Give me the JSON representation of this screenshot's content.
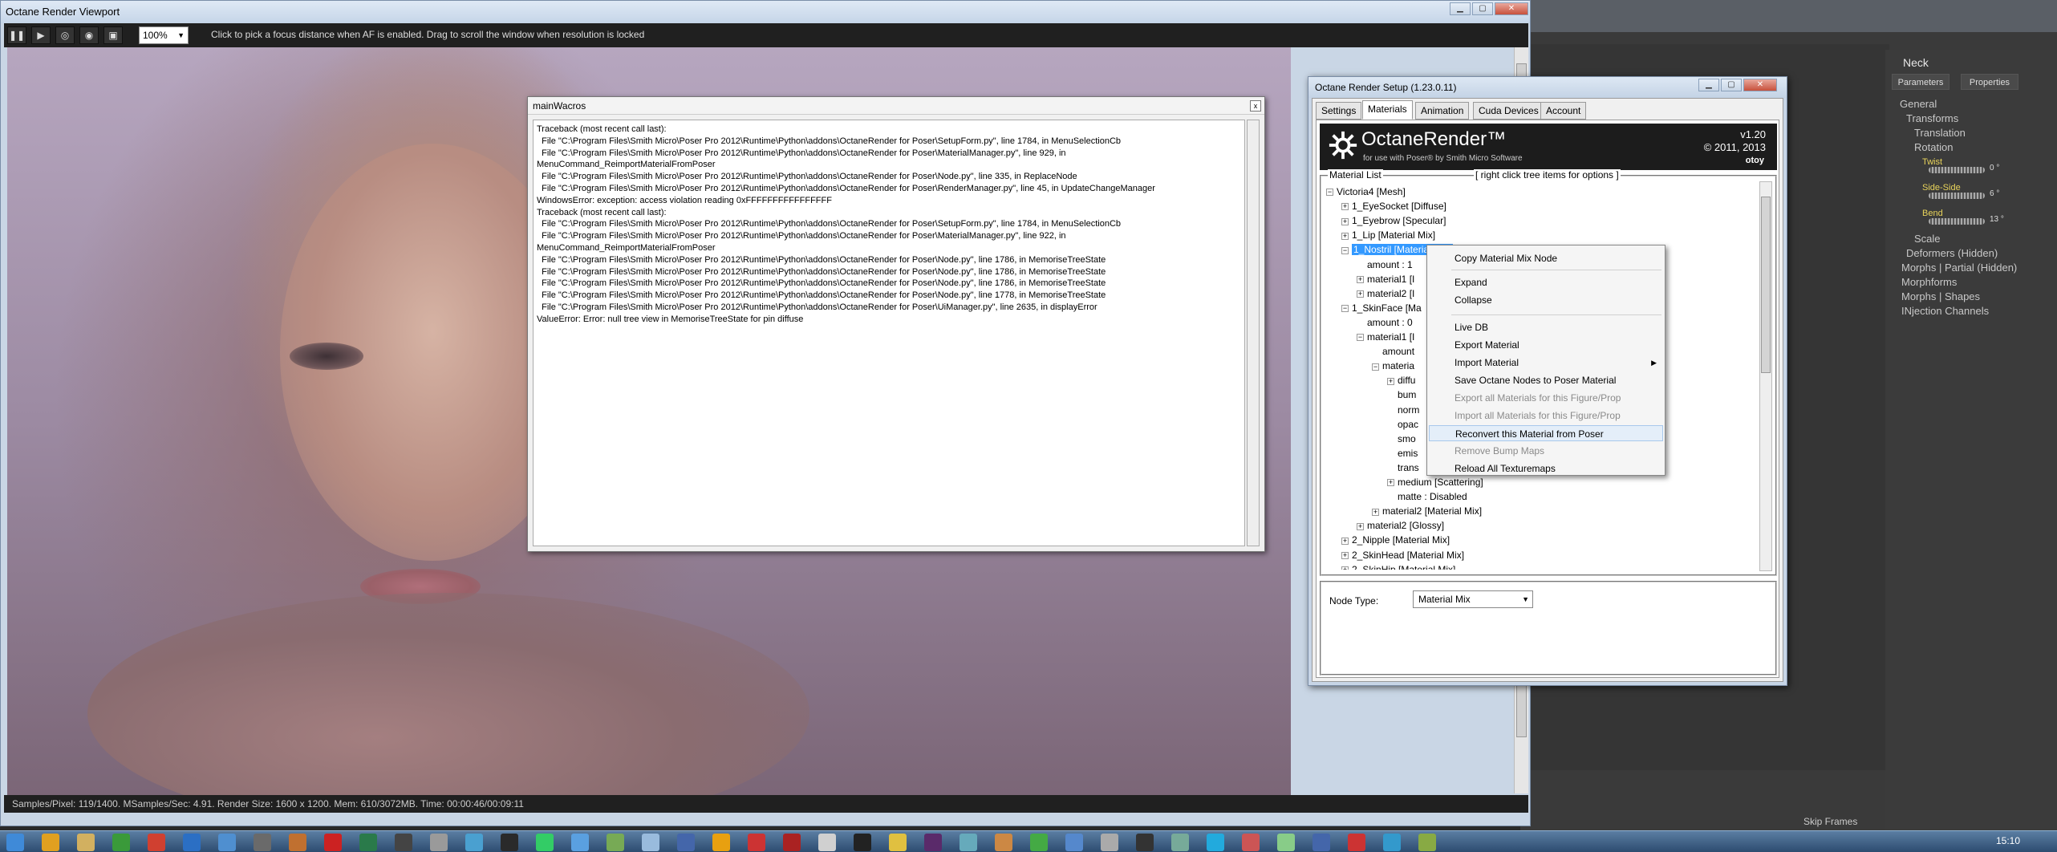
{
  "viewport": {
    "title": "Octane Render Viewport",
    "zoom": "100%",
    "hint": "Click to pick a focus distance when AF is enabled.  Drag to scroll the window when resolution is locked",
    "status": "Samples/Pixel: 119/1400.  MSamples/Sec: 4.91.  Render Size: 1600 x 1200.  Mem: 610/3072MB.  Time: 00:00:46/00:09:11"
  },
  "macros": {
    "title": "mainWacros",
    "close": "x",
    "log": "Traceback (most recent call last):\n  File \"C:\\Program Files\\Smith Micro\\Poser Pro 2012\\Runtime\\Python\\addons\\OctaneRender for Poser\\SetupForm.py\", line 1784, in MenuSelectionCb\n  File \"C:\\Program Files\\Smith Micro\\Poser Pro 2012\\Runtime\\Python\\addons\\OctaneRender for Poser\\MaterialManager.py\", line 929, in\nMenuCommand_ReimportMaterialFromPoser\n  File \"C:\\Program Files\\Smith Micro\\Poser Pro 2012\\Runtime\\Python\\addons\\OctaneRender for Poser\\Node.py\", line 335, in ReplaceNode\n  File \"C:\\Program Files\\Smith Micro\\Poser Pro 2012\\Runtime\\Python\\addons\\OctaneRender for Poser\\RenderManager.py\", line 45, in UpdateChangeManager\nWindowsError: exception: access violation reading 0xFFFFFFFFFFFFFFFF\nTraceback (most recent call last):\n  File \"C:\\Program Files\\Smith Micro\\Poser Pro 2012\\Runtime\\Python\\addons\\OctaneRender for Poser\\SetupForm.py\", line 1784, in MenuSelectionCb\n  File \"C:\\Program Files\\Smith Micro\\Poser Pro 2012\\Runtime\\Python\\addons\\OctaneRender for Poser\\MaterialManager.py\", line 922, in\nMenuCommand_ReimportMaterialFromPoser\n  File \"C:\\Program Files\\Smith Micro\\Poser Pro 2012\\Runtime\\Python\\addons\\OctaneRender for Poser\\Node.py\", line 1786, in MemoriseTreeState\n  File \"C:\\Program Files\\Smith Micro\\Poser Pro 2012\\Runtime\\Python\\addons\\OctaneRender for Poser\\Node.py\", line 1786, in MemoriseTreeState\n  File \"C:\\Program Files\\Smith Micro\\Poser Pro 2012\\Runtime\\Python\\addons\\OctaneRender for Poser\\Node.py\", line 1786, in MemoriseTreeState\n  File \"C:\\Program Files\\Smith Micro\\Poser Pro 2012\\Runtime\\Python\\addons\\OctaneRender for Poser\\Node.py\", line 1778, in MemoriseTreeState\n  File \"C:\\Program Files\\Smith Micro\\Poser Pro 2012\\Runtime\\Python\\addons\\OctaneRender for Poser\\UiManager.py\", line 2635, in displayError\nValueError: Error: null tree view in MemoriseTreeState for pin diffuse"
  },
  "octane": {
    "title": "Octane Render Setup (1.23.0.11)",
    "tabs": [
      "Settings",
      "Materials",
      "Animation",
      "Cuda Devices",
      "Account"
    ],
    "active_tab": "Materials",
    "brand": "OctaneRender™",
    "brand_sub": "for use with Poser® by Smith Micro Software",
    "version": "v1.20",
    "copyright": "© 2011, 2013",
    "otoy": "otoy",
    "material_list_label": "Material List",
    "material_list_hint": "[ right click tree items for options ]",
    "tree": [
      {
        "box": "−",
        "label": "Victoria4   [Mesh]"
      },
      {
        "box": "+",
        "label": "1_EyeSocket   [Diffuse]"
      },
      {
        "box": "+",
        "label": "1_Eyebrow   [Specular]"
      },
      {
        "box": "+",
        "label": "1_Lip   [Material Mix]"
      },
      {
        "box": "−",
        "label": "1_Nostril   [Material Mix]",
        "selected": true
      },
      {
        "box": "",
        "label": "amount  :  1"
      },
      {
        "box": "+",
        "label": "material1   [I"
      },
      {
        "box": "+",
        "label": "material2   [I"
      },
      {
        "box": "−",
        "label": "1_SkinFace   [Ma"
      },
      {
        "box": "",
        "label": "amount  :  0"
      },
      {
        "box": "−",
        "label": "material1   [I"
      },
      {
        "box": "",
        "label": "amount"
      },
      {
        "box": "−",
        "label": "materia"
      },
      {
        "box": "+",
        "label": "diffu"
      },
      {
        "box": "",
        "label": "bum"
      },
      {
        "box": "",
        "label": "norm"
      },
      {
        "box": "",
        "label": "opac"
      },
      {
        "box": "",
        "label": "smo"
      },
      {
        "box": "",
        "label": "emis"
      },
      {
        "box": "",
        "label": "trans"
      },
      {
        "box": "+",
        "label": "medium   [Scattering]"
      },
      {
        "box": "",
        "label": "matte  :  Disabled"
      },
      {
        "box": "+",
        "label": "material2   [Material Mix]"
      },
      {
        "box": "+",
        "label": "material2   [Glossy]"
      },
      {
        "box": "+",
        "label": "2_Nipple   [Material Mix]"
      },
      {
        "box": "+",
        "label": "2_SkinHead   [Material Mix]"
      },
      {
        "box": "+",
        "label": "2_SkinHip   [Material Mix]"
      }
    ],
    "node_type_label": "Node Type:",
    "node_type_value": "Material Mix"
  },
  "context_menu": {
    "items": [
      {
        "label": "Copy Material Mix Node",
        "state": "normal"
      },
      {
        "label": "Expand",
        "state": "normal"
      },
      {
        "label": "Collapse",
        "state": "normal"
      },
      {
        "label": "Live DB",
        "state": "normal"
      },
      {
        "label": "Export Material",
        "state": "normal"
      },
      {
        "label": "Import Material",
        "state": "normal",
        "submenu": "▶"
      },
      {
        "label": "Save Octane Nodes to Poser Material",
        "state": "normal"
      },
      {
        "label": "Export all Materials for this Figure/Prop",
        "state": "disabled"
      },
      {
        "label": "Import all Materials for this Figure/Prop",
        "state": "disabled"
      },
      {
        "label": "Reconvert this Material from Poser",
        "state": "hover"
      },
      {
        "label": "Remove Bump Maps",
        "state": "disabled"
      },
      {
        "label": "Reload All Texturemaps",
        "state": "normal"
      }
    ]
  },
  "poser": {
    "actor": "Neck",
    "tabs": [
      "Parameters",
      "Properties"
    ],
    "params": [
      {
        "label": "General"
      },
      {
        "label": "Transforms"
      },
      {
        "label": "Translation"
      },
      {
        "label": "Rotation"
      },
      {
        "label": "Twist",
        "value": "0 °"
      },
      {
        "label": "Side-Side",
        "value": "6 °"
      },
      {
        "label": "Bend",
        "value": "13 °"
      },
      {
        "label": "Scale"
      },
      {
        "label": "Deformers (Hidden)"
      },
      {
        "label": "Morphs | Partial (Hidden)"
      },
      {
        "label": "Morphforms"
      },
      {
        "label": "Morphs | Shapes"
      },
      {
        "label": "INjection Channels"
      }
    ],
    "skip_frames": "Skip Frames"
  },
  "taskbar": {
    "clock": "15:10"
  }
}
